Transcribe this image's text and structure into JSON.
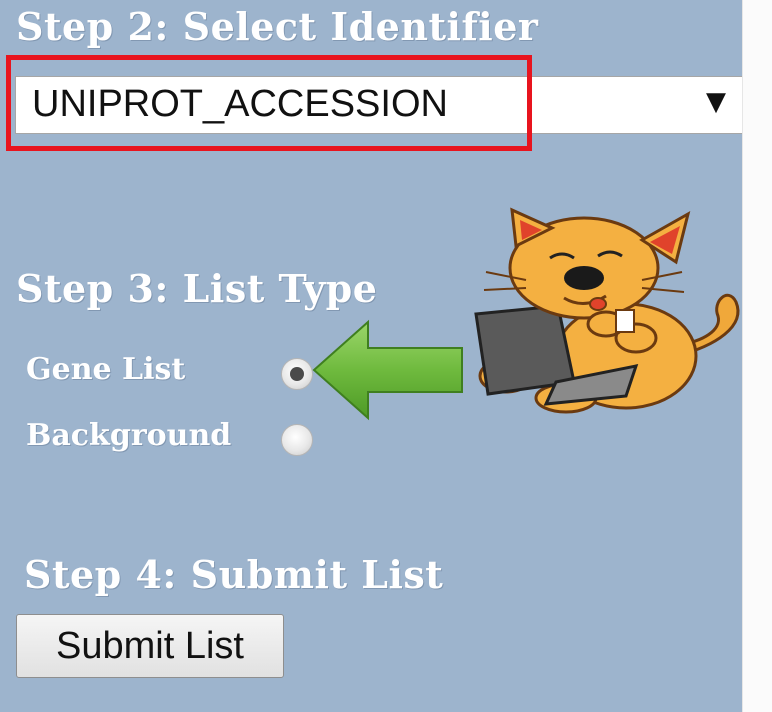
{
  "steps": {
    "step2_heading": "Step 2: Select Identifier",
    "step3_heading": "Step 3: List Type",
    "step4_heading": "Step 4: Submit List"
  },
  "identifier_select": {
    "selected_value": "UNIPROT_ACCESSION",
    "arrow_glyph": "▼"
  },
  "list_type": {
    "options": [
      {
        "label": "Gene List",
        "selected": true
      },
      {
        "label": "Background",
        "selected": false
      }
    ]
  },
  "submit": {
    "button_label": "Submit List"
  },
  "colors": {
    "panel_background": "#9db4cd",
    "highlight_border": "#e8141e",
    "arrow_fill": "#6fba3e"
  },
  "icons": {
    "callout_arrow": "green-left-arrow-icon",
    "mascot": "cat-with-laptop-icon"
  }
}
